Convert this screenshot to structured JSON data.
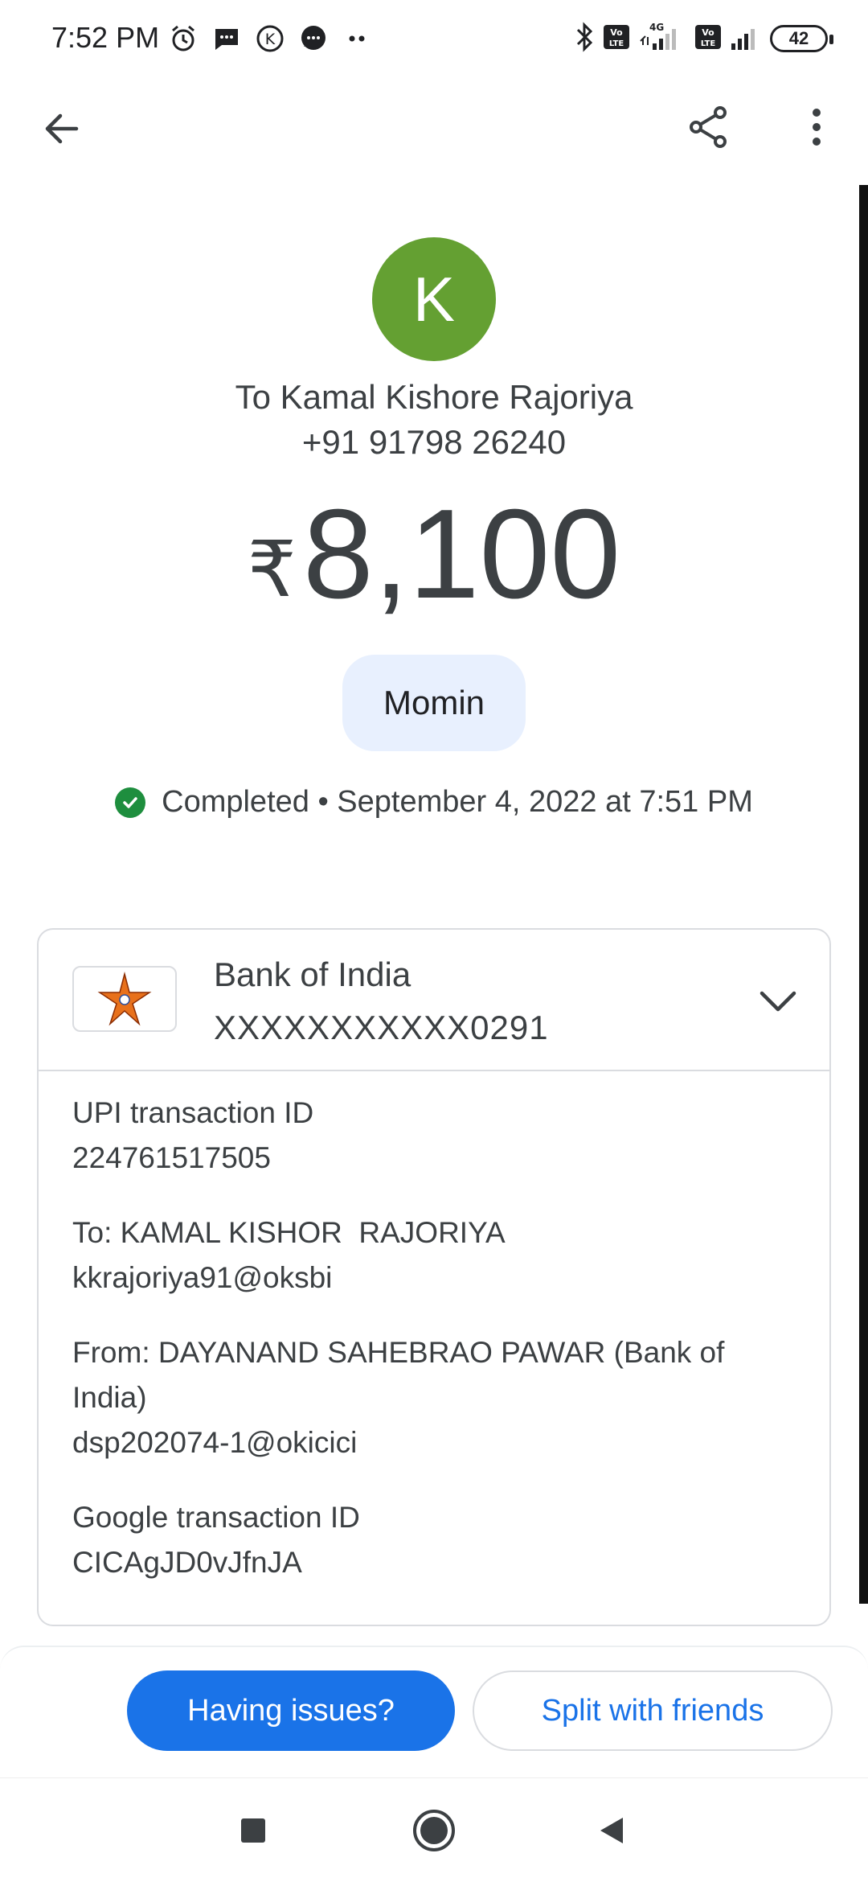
{
  "status_bar": {
    "time": "7:52 PM",
    "battery": "42",
    "left_icons": [
      "alarm-icon",
      "message-icon",
      "k-app-icon",
      "chat-icon",
      "more-dots-icon"
    ],
    "right_icons": [
      "bluetooth-icon",
      "volte-icon",
      "signal-4g-icon",
      "volte-icon",
      "signal-icon",
      "battery-icon"
    ]
  },
  "app_bar": {
    "icons": [
      "back-arrow-icon",
      "share-icon",
      "more-vert-icon"
    ]
  },
  "payee": {
    "avatar_letter": "K",
    "avatar_color": "#64a032",
    "name": "To Kamal Kishore Rajoriya",
    "phone": "+91 91798 26240"
  },
  "amount": {
    "currency": "₹",
    "value": "8,100"
  },
  "note": "Momin",
  "status": {
    "text": "Completed • September 4, 2022 at 7:51 PM",
    "color": "#1e8e3e"
  },
  "bank": {
    "name": "Bank of India",
    "account": "XXXXXXXXXXX0291"
  },
  "details": {
    "upi_label": "UPI transaction ID",
    "upi_value": "224761517505",
    "to_label": "To: KAMAL KISHOR  RAJORIYA",
    "to_value": "kkrajoriya91@oksbi",
    "from_label": "From: DAYANAND SAHEBRAO PAWAR (Bank of India)",
    "from_value": "dsp202074-1@okicici",
    "google_label": "Google transaction ID",
    "google_value": "CICAgJD0vJfnJA"
  },
  "actions": {
    "primary": "Having issues?",
    "secondary": "Split with friends",
    "accent": "#1a73e8"
  },
  "nav": {
    "icons": [
      "recents-square-icon",
      "home-circle-icon",
      "back-triangle-icon"
    ]
  }
}
